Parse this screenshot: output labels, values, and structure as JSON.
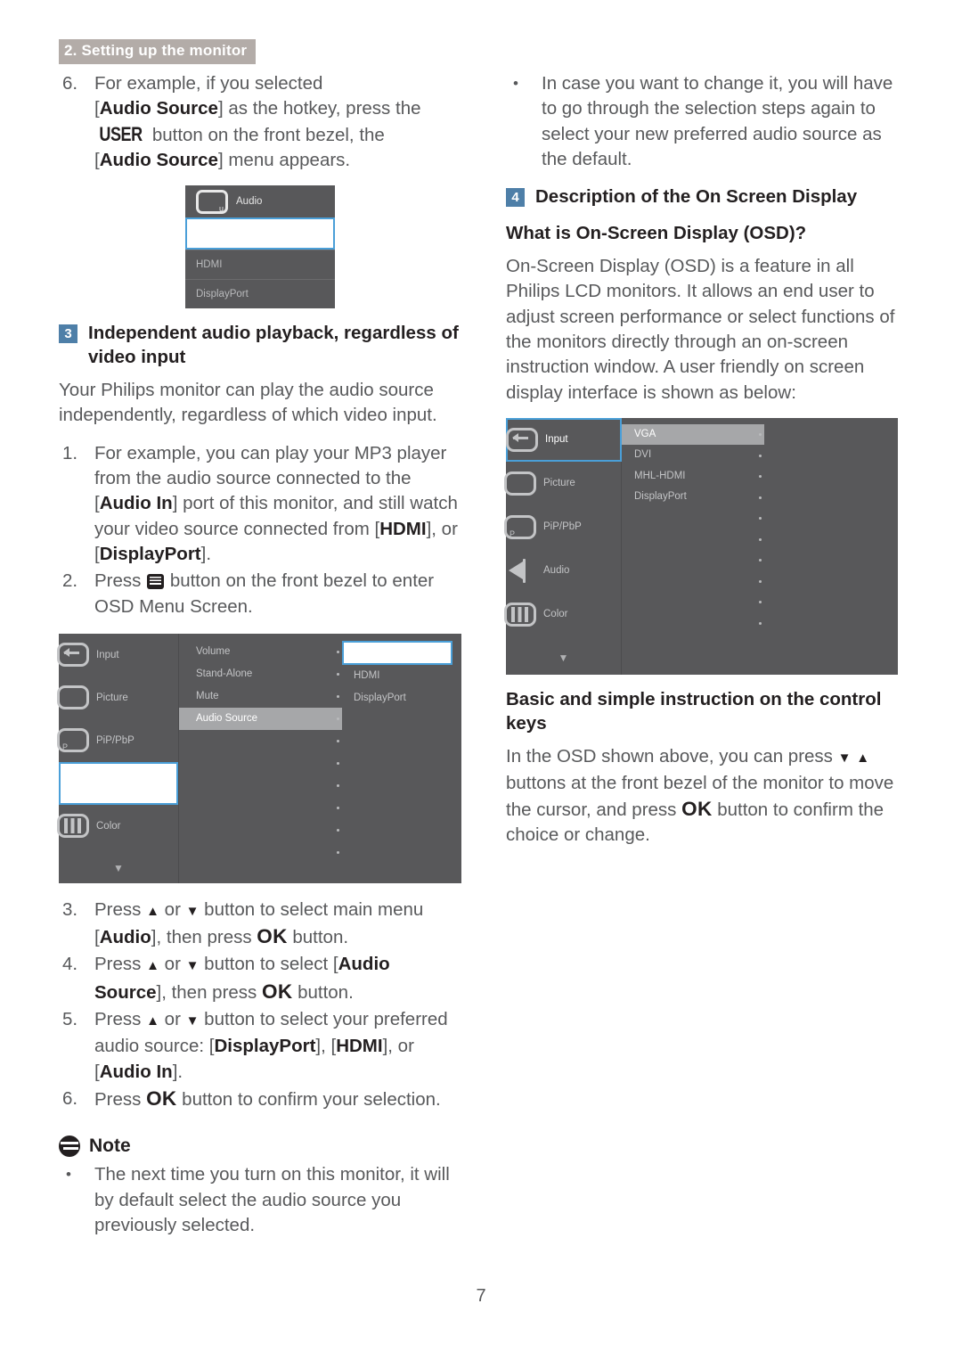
{
  "header": {
    "running_title": "2. Setting up the monitor"
  },
  "page_number": "7",
  "left_column": {
    "step6": {
      "marker": "6.",
      "line1": "For example, if you selected",
      "audio_source_open": "[",
      "audio_source_bold": "Audio Source",
      "line2_tail": "] as the hotkey, press the",
      "user_glyph": "USER",
      "line3_tail": "button on the front bezel, the",
      "line4_open": "[",
      "line4_bold": "Audio Source",
      "line4_tail": "] menu appears."
    },
    "osd_popup": {
      "head_label": "Audio",
      "u_key": "u",
      "rows": [
        {
          "label": "",
          "redacted": true
        },
        {
          "label": "HDMI",
          "redacted": false
        },
        {
          "label": "DisplayPort",
          "redacted": false
        }
      ]
    },
    "section3": {
      "badge": "3",
      "title": "Independent audio playback, regardless of video input"
    },
    "intro_paragraph": "Your Philips monitor can play the audio source independently, regardless of which video input.",
    "step1": {
      "marker": "1.",
      "part1": "For example, you can play your MP3 player from the audio source connected to the [",
      "bold1": "Audio In",
      "part2": "] port of this monitor, and still watch your video source connected from [",
      "bold2": "HDMI",
      "part3": "], or [",
      "bold3": "DisplayPort",
      "part4": "]."
    },
    "step2": {
      "marker": "2.",
      "part1": "Press",
      "part2": "button on the front bezel to enter OSD Menu Screen."
    },
    "osd_full": {
      "sidebar": [
        {
          "label": "Input",
          "icon": "input-icon",
          "state": "normal"
        },
        {
          "label": "Picture",
          "icon": "picture-icon",
          "state": "normal"
        },
        {
          "label": "PiP/PbP",
          "icon": "pip-icon",
          "state": "normal"
        },
        {
          "label": "",
          "icon": "audio-icon",
          "state": "redacted"
        },
        {
          "label": "Color",
          "icon": "color-icon",
          "state": "normal"
        }
      ],
      "caret": "▼",
      "menu_items": [
        {
          "label": "Volume",
          "highlight": false
        },
        {
          "label": "Stand-Alone",
          "highlight": false
        },
        {
          "label": "Mute",
          "highlight": false
        },
        {
          "label": "Audio Source",
          "highlight": true
        }
      ],
      "menu_blank_rows": 6,
      "values": [
        {
          "label": "",
          "redacted": true
        },
        {
          "label": "HDMI",
          "redacted": false
        },
        {
          "label": "DisplayPort",
          "redacted": false
        }
      ],
      "dot_count": 10
    },
    "step3": {
      "marker": "3.",
      "part1": "Press",
      "up": "▲",
      "or": "or",
      "down": "▼",
      "part2": "button to select main menu [",
      "bold1": "Audio",
      "part3": "], then press",
      "ok": "OK",
      "part4": "button."
    },
    "step4": {
      "marker": "4.",
      "part1": "Press",
      "up": "▲",
      "or": "or",
      "down": "▼",
      "part2": "button to select [",
      "bold1": "Audio Source",
      "part3": "], then press",
      "ok": "OK",
      "part4": "button."
    },
    "step5": {
      "marker": "5.",
      "part1": "Press",
      "up": "▲",
      "or": "or",
      "down": "▼",
      "part2": "button to select your preferred audio source: [",
      "bold1": "DisplayPort",
      "part3": "], [",
      "bold2": "HDMI",
      "part4": "], or [",
      "bold3": "Audio In",
      "part5": "]."
    },
    "step6b": {
      "marker": "6.",
      "part1": "Press",
      "ok": "OK",
      "part2": "button to confirm your selection."
    },
    "note": {
      "title": "Note",
      "bullet": "•",
      "text": "The next time you turn on this monitor, it will by default select the audio source you previously selected."
    }
  },
  "right_column": {
    "bullet_note": {
      "bullet": "•",
      "text": "In case you want to change it, you will have to go through the selection steps again to select your new preferred audio source as the default."
    },
    "section4": {
      "badge": "4",
      "title": "Description of the On Screen Display"
    },
    "subheading_osd": "What is On-Screen Display (OSD)?",
    "osd_paragraph": "On-Screen Display (OSD) is a feature in all Philips LCD monitors. It allows an end user to adjust screen performance or select functions of the monitors directly through an on-screen instruction window. A user friendly on screen display interface is shown as below:",
    "osd_full": {
      "sidebar": [
        {
          "label": "Input",
          "icon": "input-icon",
          "state": "selected"
        },
        {
          "label": "Picture",
          "icon": "picture-icon",
          "state": "normal"
        },
        {
          "label": "PiP/PbP",
          "icon": "pip-icon",
          "state": "normal"
        },
        {
          "label": "Audio",
          "icon": "audio-icon",
          "state": "normal"
        },
        {
          "label": "Color",
          "icon": "color-icon",
          "state": "normal"
        }
      ],
      "caret": "▼",
      "menu_items": [
        {
          "label": "VGA",
          "highlight": true
        },
        {
          "label": "DVI",
          "highlight": false
        },
        {
          "label": "MHL-HDMI",
          "highlight": false
        },
        {
          "label": "DisplayPort",
          "highlight": false
        }
      ],
      "menu_blank_rows": 6,
      "dot_count": 10
    },
    "subheading_keys": "Basic and simple instruction on the control keys",
    "keys_paragraph": {
      "part1": "In the OSD shown above, you can press",
      "down": "▼",
      "up": "▲",
      "part2": "buttons at the front bezel of the monitor to move the cursor, and press",
      "ok": "OK",
      "part3": "button to confirm the choice or change."
    }
  },
  "colors": {
    "accent_blue": "#4a9fd8",
    "badge_blue": "#4e7fa8",
    "header_bg": "#b3aca8",
    "osd_bg": "#58585a",
    "osd_highlight": "#a6a7a9",
    "text_gray": "#58595b",
    "text_black": "#231f20"
  }
}
